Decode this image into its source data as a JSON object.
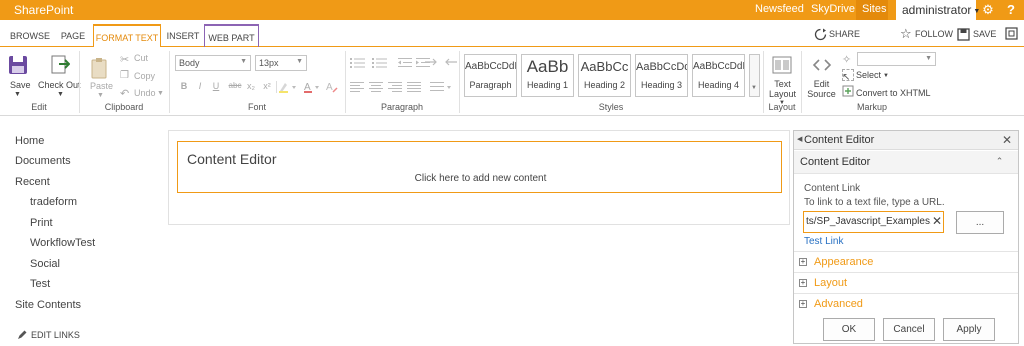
{
  "suite_bar": {
    "brand": "SharePoint",
    "links": [
      "Newsfeed",
      "SkyDrive",
      "Sites"
    ],
    "user": "administrator",
    "icons": [
      "settings-gear-icon",
      "help-icon"
    ]
  },
  "tabs": [
    "BROWSE",
    "PAGE",
    "FORMAT TEXT",
    "INSERT",
    "WEB PART"
  ],
  "active_tab": "FORMAT TEXT",
  "context_actions": {
    "share": "SHARE",
    "follow": "FOLLOW",
    "save": "SAVE"
  },
  "ribbon": {
    "edit_group": {
      "label": "Edit",
      "save": "Save",
      "check_out": "Check Out"
    },
    "clipboard_group": {
      "label": "Clipboard",
      "paste": "Paste",
      "cut": "Cut",
      "copy": "Copy",
      "undo": "Undo"
    },
    "font_group": {
      "label": "Font",
      "font_name": "Body",
      "font_size": "13px",
      "buttons": [
        "B",
        "I",
        "U",
        "abc",
        "x₂",
        "x²"
      ]
    },
    "paragraph_group": {
      "label": "Paragraph"
    },
    "styles_group": {
      "label": "Styles",
      "styles": [
        {
          "preview": "AaBbCcDdEe",
          "name": "Paragraph"
        },
        {
          "preview": "AaBb",
          "name": "Heading 1"
        },
        {
          "preview": "AaBbCc",
          "name": "Heading 2"
        },
        {
          "preview": "AaBbCcDd",
          "name": "Heading 3"
        },
        {
          "preview": "AaBbCcDdEe",
          "name": "Heading 4"
        }
      ]
    },
    "layout_group": {
      "label": "Layout",
      "text_layout": "Text Layout"
    },
    "markup_group": {
      "label": "Markup",
      "edit_source": "Edit Source",
      "select": "Select",
      "convert": "Convert to XHTML"
    }
  },
  "left_nav": {
    "items": [
      "Home",
      "Documents",
      "Recent"
    ],
    "recent_items": [
      "tradeform",
      "Print",
      "WorkflowTest",
      "Social",
      "Test"
    ],
    "site_contents": "Site Contents",
    "edit_links": "EDIT LINKS"
  },
  "web_part": {
    "title": "Content Editor",
    "placeholder": "Click here to add new content"
  },
  "tool_pane": {
    "title": "Content Editor",
    "section_title": "Content Editor",
    "content_link_label": "Content Link",
    "content_link_help": "To link to a text file, type a URL.",
    "content_link_value": "ts/SP_Javascript_Examples.js",
    "browse_button": "...",
    "test_link": "Test Link",
    "sections": [
      "Appearance",
      "Layout",
      "Advanced"
    ],
    "buttons": {
      "ok": "OK",
      "cancel": "Cancel",
      "apply": "Apply"
    }
  },
  "colors": {
    "accent": "#f09a16",
    "link": "#2770c2",
    "web_part_tab": "#8c64b4"
  }
}
